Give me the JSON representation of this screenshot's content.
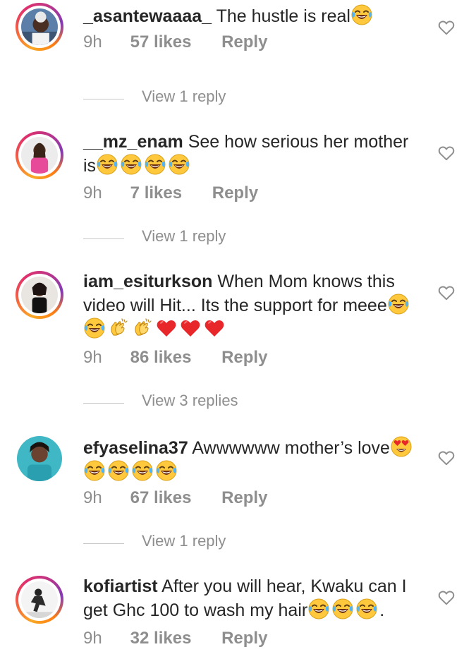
{
  "comments": [
    {
      "username": "_asantewaaaa_",
      "text": " The hustle is real",
      "emojis": [
        "laugh-cry"
      ],
      "time": "9h",
      "likes": "57 likes",
      "reply": "Reply",
      "view_replies": "View 1 reply"
    },
    {
      "username": "__mz_enam",
      "text": " See how serious her mother is",
      "emojis": [
        "laugh-cry",
        "laugh-cry",
        "laugh-cry",
        "laugh-cry"
      ],
      "time": "9h",
      "likes": "7 likes",
      "reply": "Reply",
      "view_replies": "View 1 reply"
    },
    {
      "username": "iam_esiturkson",
      "text": " When Mom knows this video will Hit... Its the support for meee",
      "emojis": [
        "laugh-cry",
        "laugh-cry",
        "clapping-hands",
        "clapping-hands",
        "red-heart",
        "red-heart",
        "red-heart"
      ],
      "time": "9h",
      "likes": "86 likes",
      "reply": "Reply",
      "view_replies": "View 3 replies"
    },
    {
      "username": "efyaselina37",
      "text": " Awwwwww mother’s love",
      "emojis": [
        "heart-eyes",
        "laugh-cry",
        "laugh-cry",
        "laugh-cry",
        "laugh-cry"
      ],
      "time": "9h",
      "likes": "67 likes",
      "reply": "Reply",
      "view_replies": "View 1 reply"
    },
    {
      "username": "kofiartist",
      "text": " After you will hear, Kwaku can I get Ghc 100 to wash my hair",
      "emojis": [
        "laugh-cry",
        "laugh-cry",
        "laugh-cry"
      ],
      "text_suffix": ".",
      "time": "9h",
      "likes": "32 likes",
      "reply": "Reply"
    }
  ],
  "icons": {
    "like": "heart-outline-icon",
    "avatar": "user-avatar"
  },
  "colors": {
    "meta_text": "#8e8e8e",
    "body_text": "#262626",
    "heart_emoji": "#e8272b",
    "emoji_yellow": "#ffc83d"
  }
}
